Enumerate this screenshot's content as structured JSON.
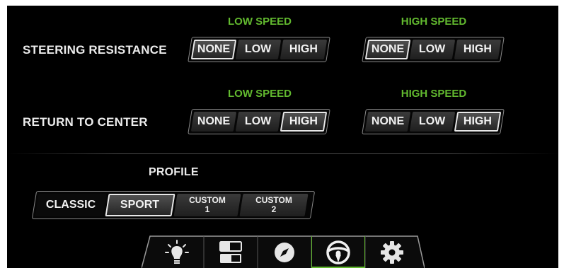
{
  "steering_resistance": {
    "label": "STEERING RESISTANCE",
    "low_speed": {
      "header": "LOW SPEED",
      "options": [
        "NONE",
        "LOW",
        "HIGH"
      ],
      "selected": "NONE"
    },
    "high_speed": {
      "header": "HIGH SPEED",
      "options": [
        "NONE",
        "LOW",
        "HIGH"
      ],
      "selected": "NONE"
    }
  },
  "return_to_center": {
    "label": "RETURN TO CENTER",
    "low_speed": {
      "header": "LOW SPEED",
      "options": [
        "NONE",
        "LOW",
        "HIGH"
      ],
      "selected": "HIGH"
    },
    "high_speed": {
      "header": "HIGH SPEED",
      "options": [
        "NONE",
        "LOW",
        "HIGH"
      ],
      "selected": "HIGH"
    }
  },
  "profile": {
    "title": "PROFILE",
    "options": [
      {
        "label": "CLASSIC",
        "line2": ""
      },
      {
        "label": "SPORT",
        "line2": ""
      },
      {
        "label": "CUSTOM",
        "line2": "1"
      },
      {
        "label": "CUSTOM",
        "line2": "2"
      }
    ],
    "selected": "SPORT"
  },
  "tabs": [
    {
      "icon": "light-bulb-icon"
    },
    {
      "icon": "layout-toggle-icon"
    },
    {
      "icon": "compass-icon"
    },
    {
      "icon": "steering-wheel-icon",
      "active": true
    },
    {
      "icon": "gear-icon"
    }
  ],
  "colors": {
    "accent": "#62b92f",
    "background": "#000000",
    "text": "#ececec"
  }
}
